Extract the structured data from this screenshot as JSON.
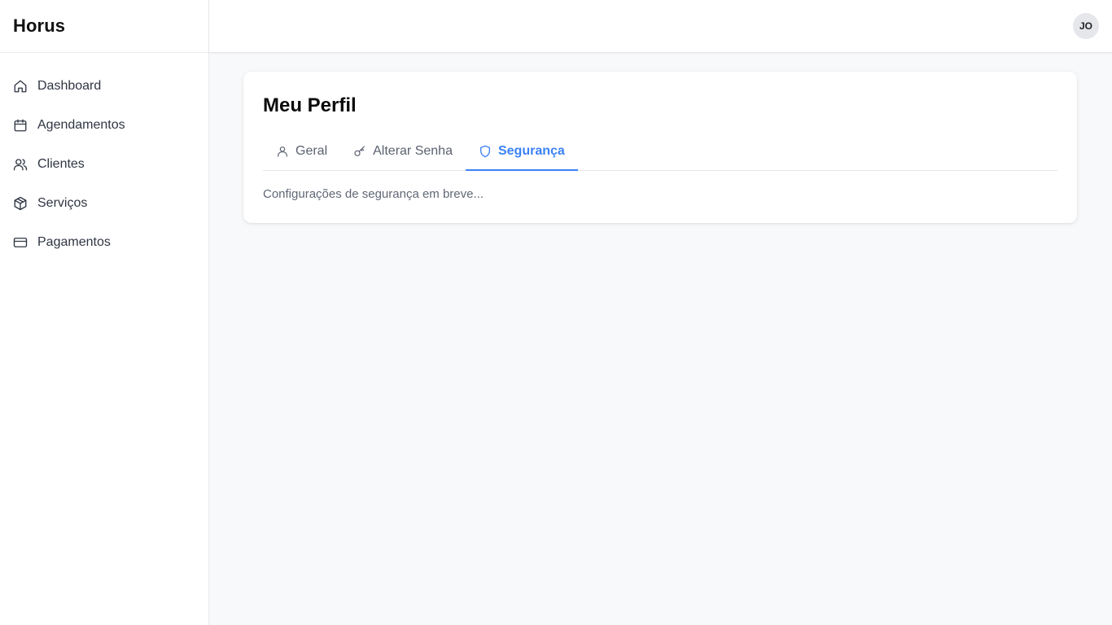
{
  "app": {
    "name": "Horus"
  },
  "sidebar": {
    "items": [
      {
        "label": "Dashboard",
        "icon": "home-icon"
      },
      {
        "label": "Agendamentos",
        "icon": "calendar-icon"
      },
      {
        "label": "Clientes",
        "icon": "users-icon"
      },
      {
        "label": "Serviços",
        "icon": "package-icon"
      },
      {
        "label": "Pagamentos",
        "icon": "credit-card-icon"
      }
    ]
  },
  "header": {
    "avatar_initials": "JO"
  },
  "profile": {
    "title": "Meu Perfil",
    "tabs": [
      {
        "label": "Geral",
        "icon": "user-icon",
        "active": false
      },
      {
        "label": "Alterar Senha",
        "icon": "key-icon",
        "active": false
      },
      {
        "label": "Segurança",
        "icon": "shield-icon",
        "active": true
      }
    ],
    "content": "Configurações de segurança em breve..."
  },
  "colors": {
    "accent": "#3b82f6",
    "background": "#f8f9fb"
  }
}
